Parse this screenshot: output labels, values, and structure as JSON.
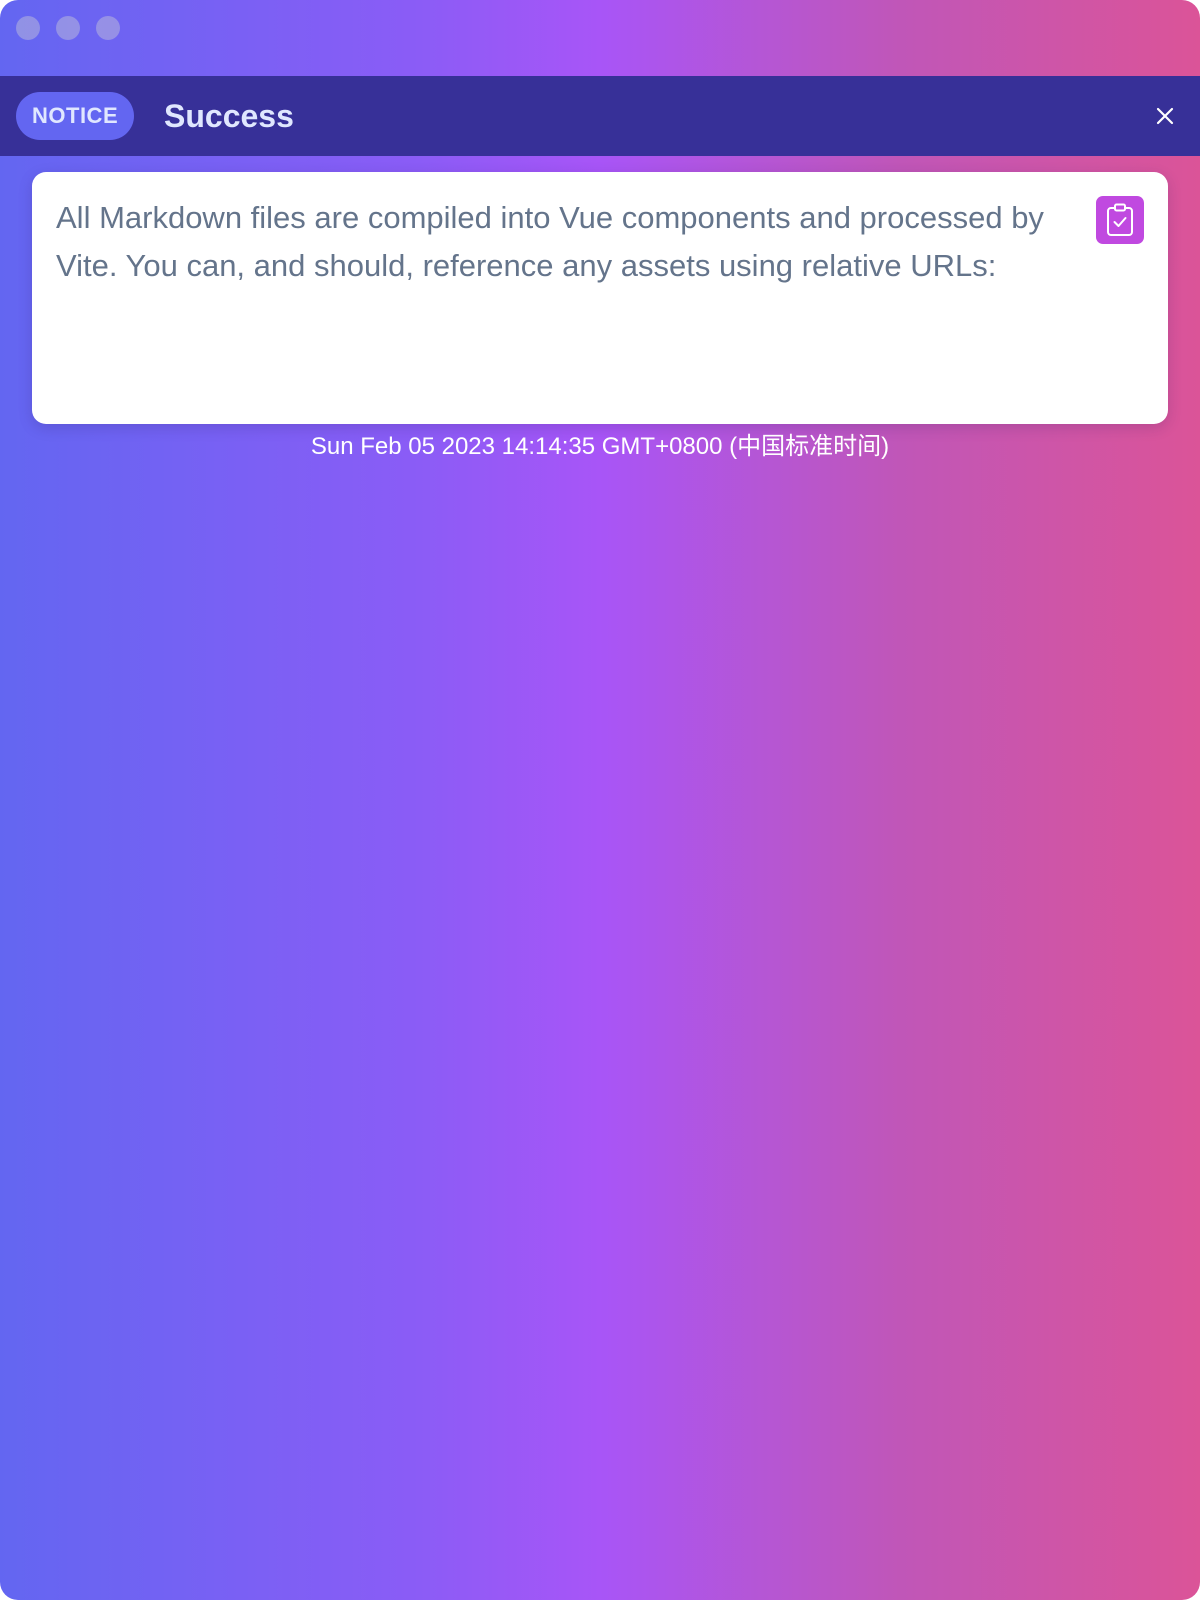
{
  "window": {
    "controls": [
      "close",
      "minimize",
      "zoom"
    ]
  },
  "header": {
    "badge": "NOTICE",
    "title": "Success",
    "close_icon": "close-icon"
  },
  "message": {
    "text": "All Markdown files are compiled into Vue components and processed by Vite. You can, and should, reference any assets using relative URLs:",
    "copy_icon": "clipboard-check-icon"
  },
  "timestamp": "Sun Feb 05 2023 14:14:35 GMT+0800 (中国标准时间)",
  "colors": {
    "header_bg": "#373098",
    "badge_bg": "#6366f1",
    "gradient_start": "#6366f1",
    "gradient_mid": "#a855f7",
    "gradient_end": "#db5498",
    "copy_button_bg": "#c049e0",
    "message_text": "#64748b"
  }
}
